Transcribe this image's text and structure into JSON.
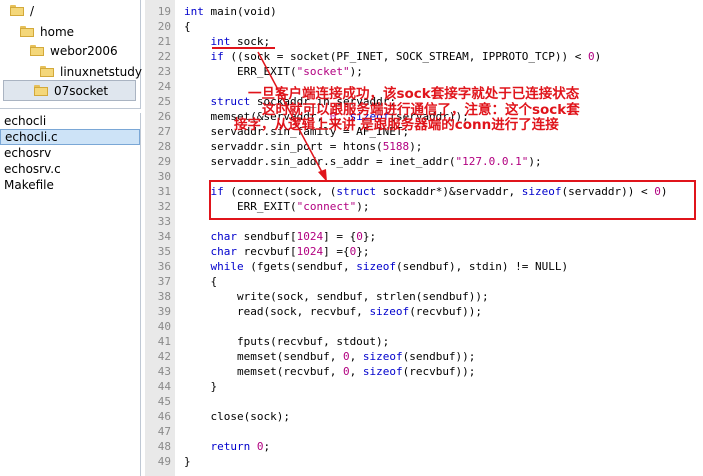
{
  "tree": {
    "items": [
      {
        "label": "/",
        "depth": 0,
        "selected": false
      },
      {
        "label": "home",
        "depth": 1,
        "selected": false
      },
      {
        "label": "webor2006",
        "depth": 2,
        "selected": false
      },
      {
        "label": "linuxnetstudy",
        "depth": 3,
        "selected": false
      },
      {
        "label": "07socket",
        "depth": 4,
        "selected": true
      }
    ]
  },
  "files": {
    "items": [
      {
        "label": "echocli",
        "selected": false
      },
      {
        "label": "echocli.c",
        "selected": true
      },
      {
        "label": "echosrv",
        "selected": false
      },
      {
        "label": "echosrv.c",
        "selected": false
      },
      {
        "label": "Makefile",
        "selected": false
      }
    ]
  },
  "editor": {
    "lines": [
      {
        "n": "19",
        "segs": [
          {
            "t": "int",
            "c": "kw"
          },
          {
            "t": " main(void)",
            "c": ""
          }
        ]
      },
      {
        "n": "20",
        "segs": [
          {
            "t": "{",
            "c": ""
          }
        ]
      },
      {
        "n": "21",
        "segs": [
          {
            "t": "    ",
            "c": ""
          },
          {
            "t": "int",
            "c": "kw"
          },
          {
            "t": " sock;",
            "c": ""
          }
        ]
      },
      {
        "n": "22",
        "segs": [
          {
            "t": "    ",
            "c": ""
          },
          {
            "t": "if",
            "c": "kw"
          },
          {
            "t": " ((sock = socket(PF_INET, SOCK_STREAM, IPPROTO_TCP)) < ",
            "c": ""
          },
          {
            "t": "0",
            "c": "num"
          },
          {
            "t": ")",
            "c": ""
          }
        ]
      },
      {
        "n": "23",
        "segs": [
          {
            "t": "        ERR_EXIT(",
            "c": ""
          },
          {
            "t": "\"socket\"",
            "c": "st"
          },
          {
            "t": ");",
            "c": ""
          }
        ]
      },
      {
        "n": "24",
        "segs": []
      },
      {
        "n": "25",
        "segs": [
          {
            "t": "    ",
            "c": ""
          },
          {
            "t": "struct",
            "c": "kw"
          },
          {
            "t": " sockaddr_in servaddr;",
            "c": ""
          }
        ]
      },
      {
        "n": "26",
        "segs": [
          {
            "t": "    memset(&servaddr, ",
            "c": ""
          },
          {
            "t": "0",
            "c": "num"
          },
          {
            "t": ", ",
            "c": ""
          },
          {
            "t": "sizeof",
            "c": "kw"
          },
          {
            "t": "(servaddr));",
            "c": ""
          }
        ]
      },
      {
        "n": "27",
        "segs": [
          {
            "t": "    servaddr.sin_family = AF_INET;",
            "c": ""
          }
        ]
      },
      {
        "n": "28",
        "segs": [
          {
            "t": "    servaddr.sin_port = htons(",
            "c": ""
          },
          {
            "t": "5188",
            "c": "num"
          },
          {
            "t": ");",
            "c": ""
          }
        ]
      },
      {
        "n": "29",
        "segs": [
          {
            "t": "    servaddr.sin_addr.s_addr = inet_addr(",
            "c": ""
          },
          {
            "t": "\"127.0.0.1\"",
            "c": "st"
          },
          {
            "t": ");",
            "c": ""
          }
        ]
      },
      {
        "n": "30",
        "segs": []
      },
      {
        "n": "31",
        "segs": [
          {
            "t": "    ",
            "c": ""
          },
          {
            "t": "if",
            "c": "kw"
          },
          {
            "t": " (connect(sock, (",
            "c": ""
          },
          {
            "t": "struct",
            "c": "kw"
          },
          {
            "t": " sockaddr*)&servaddr, ",
            "c": ""
          },
          {
            "t": "sizeof",
            "c": "kw"
          },
          {
            "t": "(servaddr)) < ",
            "c": ""
          },
          {
            "t": "0",
            "c": "num"
          },
          {
            "t": ")",
            "c": ""
          }
        ]
      },
      {
        "n": "32",
        "segs": [
          {
            "t": "        ERR_EXIT(",
            "c": ""
          },
          {
            "t": "\"connect\"",
            "c": "st"
          },
          {
            "t": ");",
            "c": ""
          }
        ]
      },
      {
        "n": "33",
        "segs": []
      },
      {
        "n": "34",
        "segs": [
          {
            "t": "    ",
            "c": ""
          },
          {
            "t": "char",
            "c": "kw"
          },
          {
            "t": " sendbuf[",
            "c": ""
          },
          {
            "t": "1024",
            "c": "num"
          },
          {
            "t": "] = {",
            "c": ""
          },
          {
            "t": "0",
            "c": "num"
          },
          {
            "t": "};",
            "c": ""
          }
        ]
      },
      {
        "n": "35",
        "segs": [
          {
            "t": "    ",
            "c": ""
          },
          {
            "t": "char",
            "c": "kw"
          },
          {
            "t": " recvbuf[",
            "c": ""
          },
          {
            "t": "1024",
            "c": "num"
          },
          {
            "t": "] ={",
            "c": ""
          },
          {
            "t": "0",
            "c": "num"
          },
          {
            "t": "};",
            "c": ""
          }
        ]
      },
      {
        "n": "36",
        "segs": [
          {
            "t": "    ",
            "c": ""
          },
          {
            "t": "while",
            "c": "kw"
          },
          {
            "t": " (fgets(sendbuf, ",
            "c": ""
          },
          {
            "t": "sizeof",
            "c": "kw"
          },
          {
            "t": "(sendbuf), stdin) != NULL)",
            "c": ""
          }
        ]
      },
      {
        "n": "37",
        "segs": [
          {
            "t": "    {",
            "c": ""
          }
        ]
      },
      {
        "n": "38",
        "segs": [
          {
            "t": "        write(sock, sendbuf, strlen(sendbuf));",
            "c": ""
          }
        ]
      },
      {
        "n": "39",
        "segs": [
          {
            "t": "        read(sock, recvbuf, ",
            "c": ""
          },
          {
            "t": "sizeof",
            "c": "kw"
          },
          {
            "t": "(recvbuf));",
            "c": ""
          }
        ]
      },
      {
        "n": "40",
        "segs": []
      },
      {
        "n": "41",
        "segs": [
          {
            "t": "        fputs(recvbuf, stdout);",
            "c": ""
          }
        ]
      },
      {
        "n": "42",
        "segs": [
          {
            "t": "        memset(sendbuf, ",
            "c": ""
          },
          {
            "t": "0",
            "c": "num"
          },
          {
            "t": ", ",
            "c": ""
          },
          {
            "t": "sizeof",
            "c": "kw"
          },
          {
            "t": "(sendbuf));",
            "c": ""
          }
        ]
      },
      {
        "n": "43",
        "segs": [
          {
            "t": "        memset(recvbuf, ",
            "c": ""
          },
          {
            "t": "0",
            "c": "num"
          },
          {
            "t": ", ",
            "c": ""
          },
          {
            "t": "sizeof",
            "c": "kw"
          },
          {
            "t": "(recvbuf));",
            "c": ""
          }
        ]
      },
      {
        "n": "44",
        "segs": [
          {
            "t": "    }",
            "c": ""
          }
        ]
      },
      {
        "n": "45",
        "segs": []
      },
      {
        "n": "46",
        "segs": [
          {
            "t": "    close(sock);",
            "c": ""
          }
        ]
      },
      {
        "n": "47",
        "segs": []
      },
      {
        "n": "48",
        "segs": [
          {
            "t": "    ",
            "c": ""
          },
          {
            "t": "return",
            "c": "kw"
          },
          {
            "t": " ",
            "c": ""
          },
          {
            "t": "0",
            "c": "num"
          },
          {
            "t": ";",
            "c": ""
          }
        ]
      },
      {
        "n": "49",
        "segs": [
          {
            "t": "}",
            "c": ""
          }
        ]
      }
    ]
  },
  "annotation": {
    "line1": "一旦客户端连接成功，该sock套接字就处于已连接状态",
    "line2": "这时就可以跟服务端进行通信了，注意：这个sock套",
    "line3": "接字，从逻辑上来讲 是跟服务器端的conn进行了连接",
    "color": "#e0141b"
  },
  "colors": {
    "keyword": "#0000cc",
    "string": "#b20080",
    "gutter": "#e9e9e9",
    "selection": "#cde3f7"
  }
}
